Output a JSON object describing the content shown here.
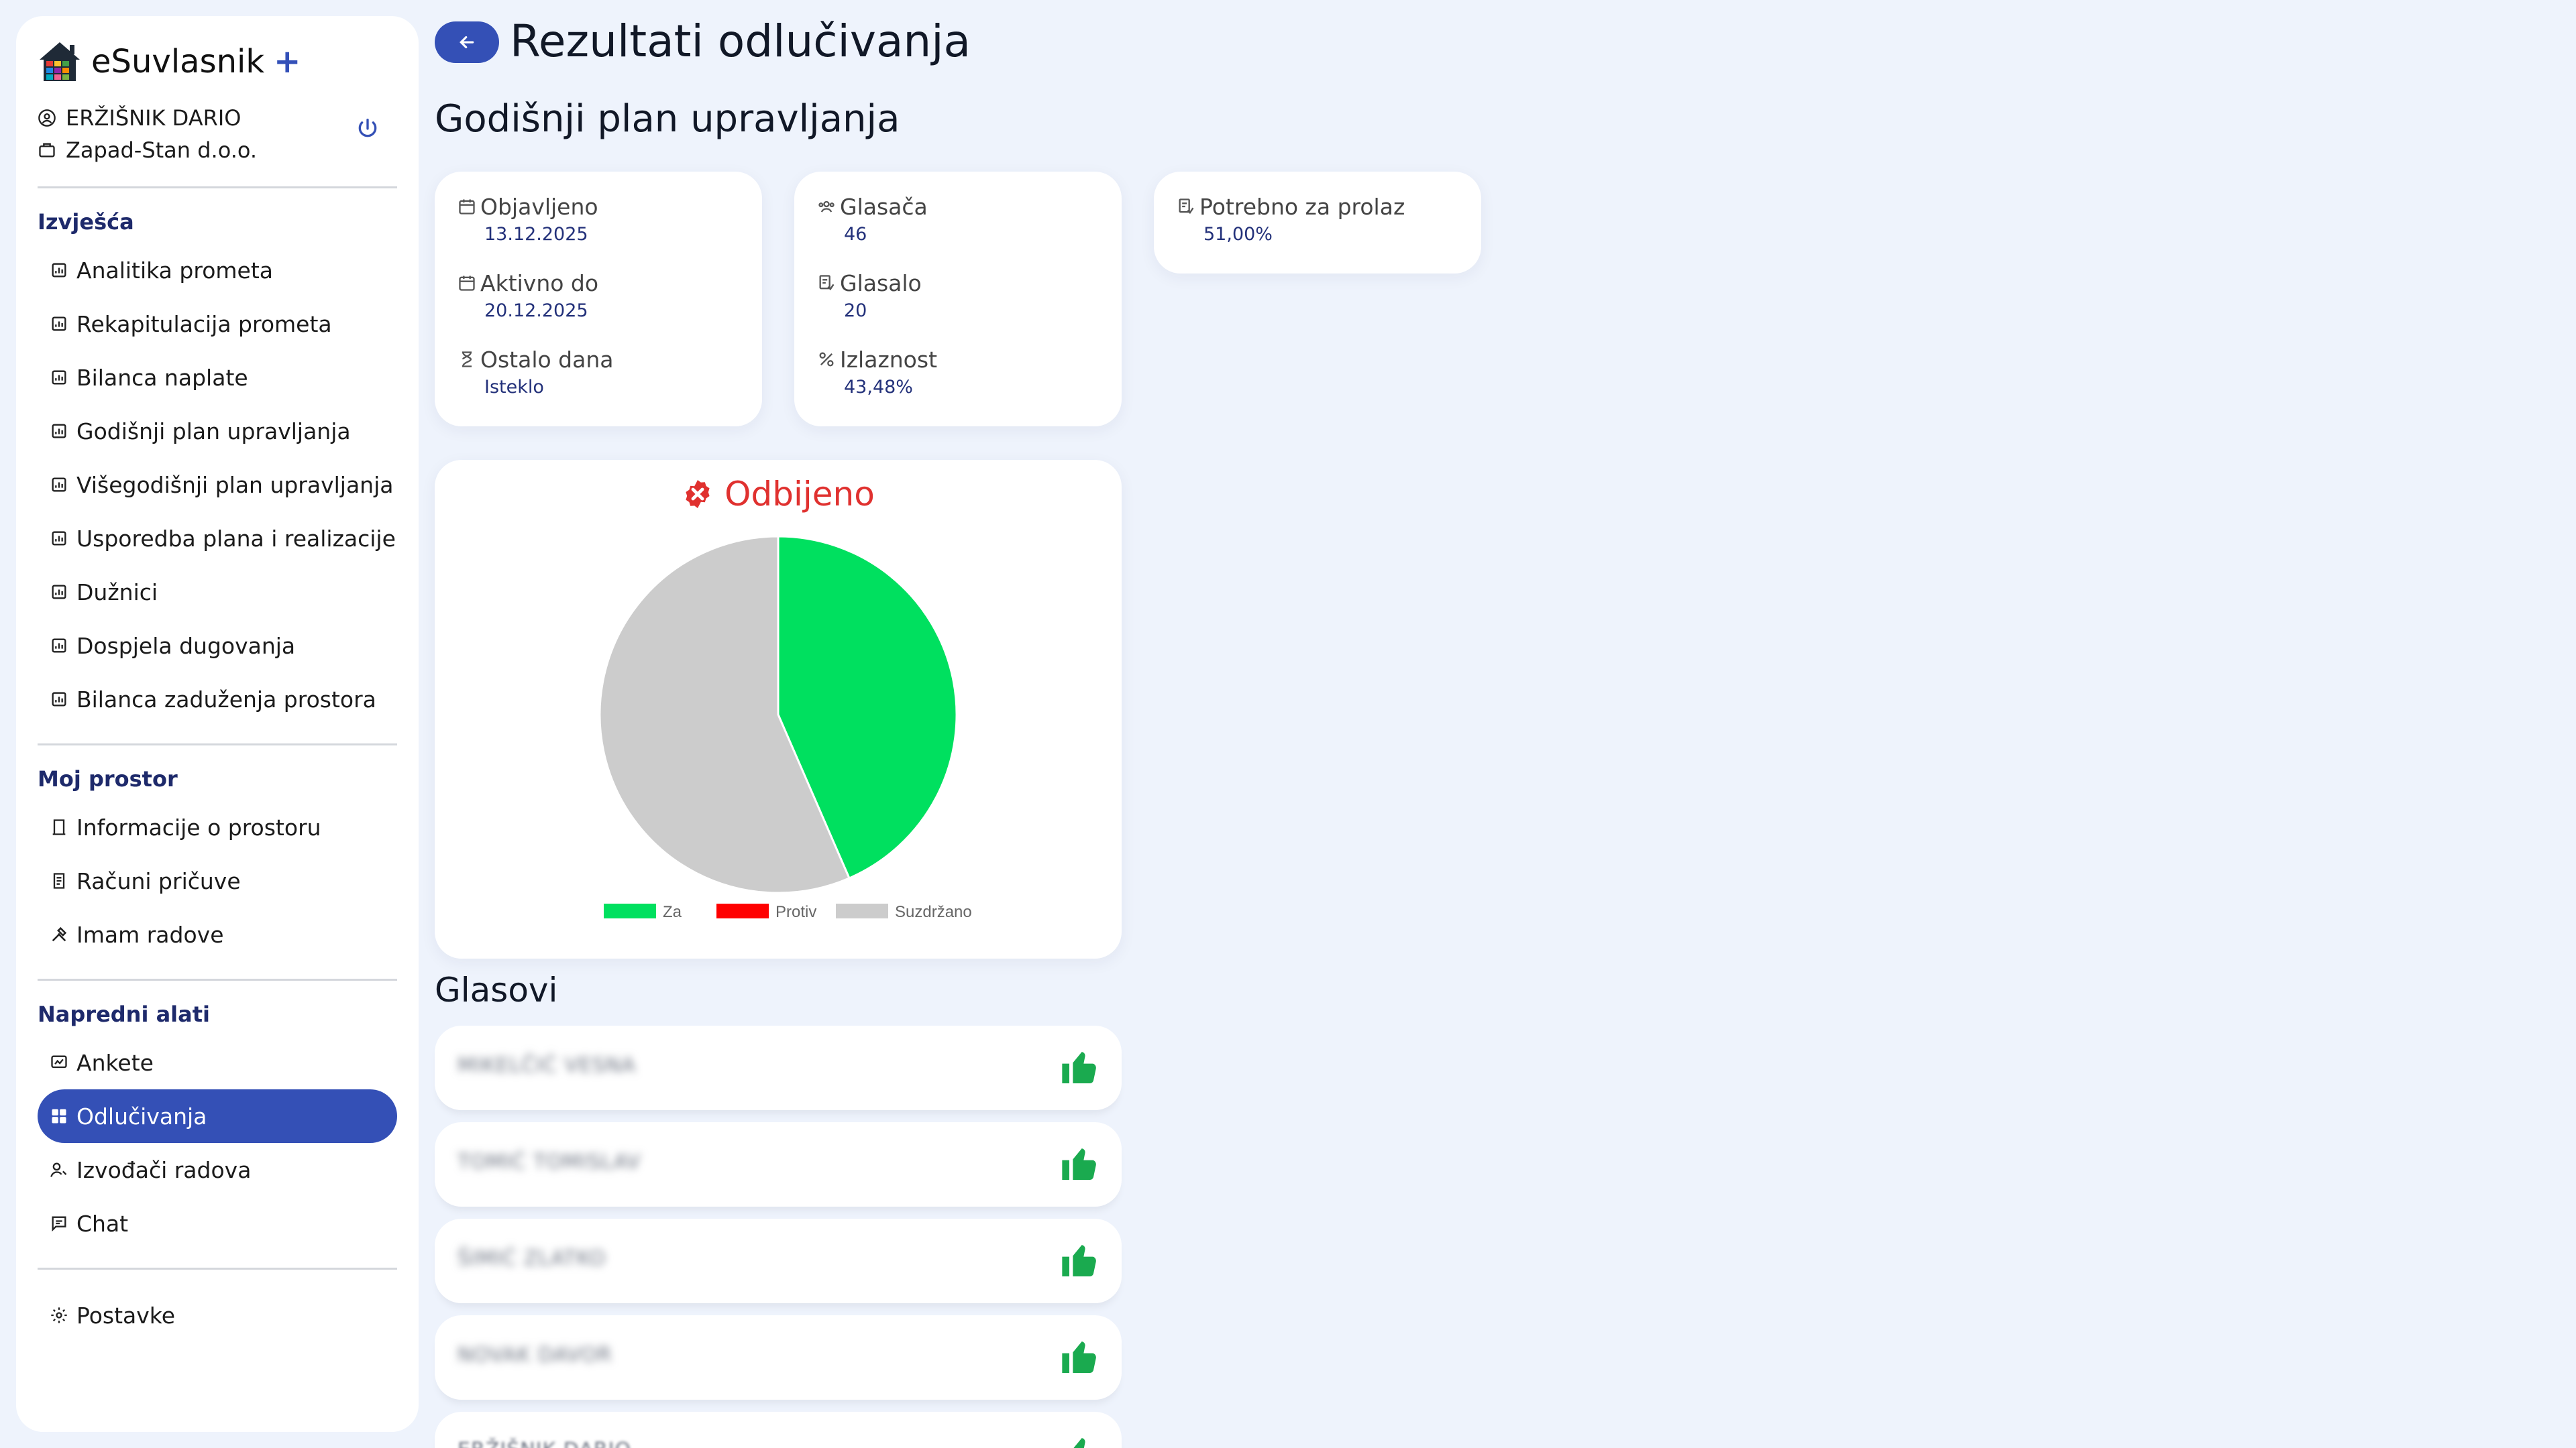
{
  "brand": {
    "name": "eSuvlasnik",
    "plus": "+"
  },
  "user": {
    "name": "ERŽIŠNIK DARIO",
    "company": "Zapad-Stan d.o.o."
  },
  "sidebar": {
    "sections": [
      {
        "title": "Izvješća",
        "items": [
          {
            "label": "Analitika prometa",
            "icon": "report-icon"
          },
          {
            "label": "Rekapitulacija prometa",
            "icon": "report-icon"
          },
          {
            "label": "Bilanca naplate",
            "icon": "report-icon"
          },
          {
            "label": "Godišnji plan upravljanja",
            "icon": "report-icon"
          },
          {
            "label": "Višegodišnji plan upravljanja",
            "icon": "report-icon"
          },
          {
            "label": "Usporedba plana i realizacije",
            "icon": "report-icon"
          },
          {
            "label": "Dužnici",
            "icon": "report-icon"
          },
          {
            "label": "Dospjela dugovanja",
            "icon": "report-icon"
          },
          {
            "label": "Bilanca zaduženja prostora",
            "icon": "report-icon"
          }
        ]
      },
      {
        "title": "Moj prostor",
        "items": [
          {
            "label": "Informacije o prostoru",
            "icon": "building-icon"
          },
          {
            "label": "Računi pričuve",
            "icon": "invoice-icon"
          },
          {
            "label": "Imam radove",
            "icon": "tools-icon"
          }
        ]
      },
      {
        "title": "Napredni alati",
        "items": [
          {
            "label": "Ankete",
            "icon": "poll-icon"
          },
          {
            "label": "Odlučivanja",
            "icon": "grid-icon",
            "active": true
          },
          {
            "label": "Izvođači radova",
            "icon": "contractor-icon"
          },
          {
            "label": "Chat",
            "icon": "chat-icon"
          }
        ]
      }
    ],
    "settings": {
      "label": "Postavke",
      "icon": "gear-icon"
    }
  },
  "header": {
    "title": "Rezultati odlučivanja",
    "subtitle": "Godišnji plan upravljanja"
  },
  "info": {
    "published_label": "Objavljeno",
    "published": "13.12.2025",
    "active_label": "Aktivno do",
    "active": "20.12.2025",
    "remaining_label": "Ostalo dana",
    "remaining": "Isteklo",
    "voters_label": "Glasača",
    "voters": "46",
    "voted_label": "Glasalo",
    "voted": "20",
    "turnout_label": "Izlaznost",
    "turnout": "43,48%",
    "required_label": "Potrebno za prolaz",
    "required": "51,00%"
  },
  "result": {
    "status": "Odbijeno",
    "status_color": "#e0312f"
  },
  "chart_data": {
    "type": "pie",
    "categories": [
      "Za",
      "Protiv",
      "Suzdržano"
    ],
    "values": [
      20,
      0,
      26
    ],
    "colors": [
      "#00e05f",
      "#ff0000",
      "#cccccc"
    ],
    "legend": "bottom"
  },
  "votes": {
    "title": "Glasovi",
    "items": [
      {
        "name": "MIKELČIĆ VESNA",
        "vote": "thumbs-up-icon"
      },
      {
        "name": "TOMIĆ TOMISLAV",
        "vote": "thumbs-up-icon"
      },
      {
        "name": "ŠIMIĆ ZLATKO",
        "vote": "thumbs-up-icon"
      },
      {
        "name": "NOVAK DAVOR",
        "vote": "thumbs-up-icon"
      },
      {
        "name": "ERŽIŠNIK DARIO",
        "vote": "thumbs-up-icon"
      }
    ]
  },
  "colors": {
    "accent": "#3450b6",
    "vote_up": "#1aaa4f",
    "background": "#eef3fc"
  }
}
